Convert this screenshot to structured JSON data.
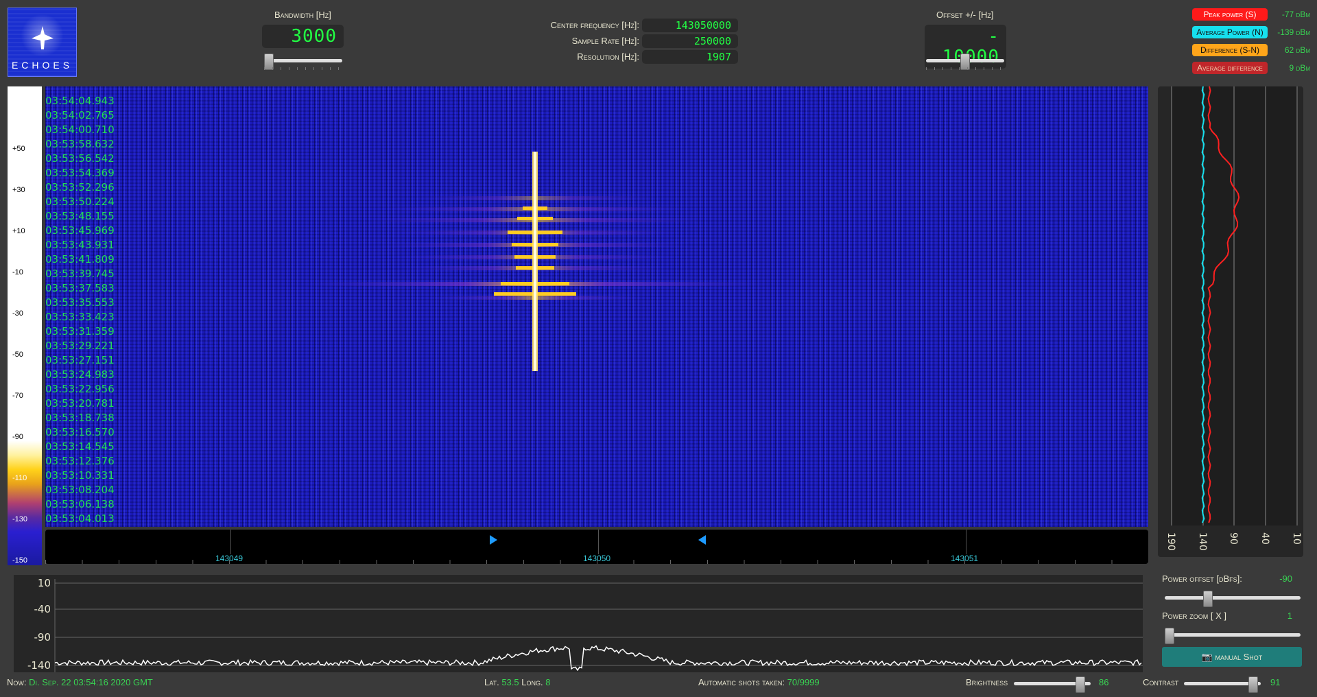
{
  "logo": {
    "text": "ECHOES"
  },
  "bandwidth": {
    "label": "Bandwidth [Hz]",
    "value": "3000"
  },
  "center": {
    "freq_label": "Center frequency [Hz]:",
    "freq_value": "143050000",
    "sr_label": "Sample Rate [Hz]:",
    "sr_value": "250000",
    "res_label": "Resolution [Hz]:",
    "res_value": "1907"
  },
  "offset": {
    "label": "Offset +/- [Hz]",
    "value": "- 10000"
  },
  "power": [
    {
      "label": "Peak power (S)",
      "value": "-77 dBm",
      "color": "#ff1a1a",
      "text_color": "#ffffff"
    },
    {
      "label": "Average Power (N)",
      "value": "-139 dBm",
      "color": "#16e0ee",
      "text_color": "#111111"
    },
    {
      "label": "Difference (S-N)",
      "value": "62 dBm",
      "color": "#ffa51a",
      "text_color": "#111111"
    },
    {
      "label": "Average difference",
      "value": "9 dBm",
      "color": "#c0262a",
      "text_color": "#f0d0b0"
    }
  ],
  "colorbar_ticks": [
    "+50",
    "+30",
    "+10",
    "-10",
    "-30",
    "-50",
    "-70",
    "-90",
    "-110",
    "-130",
    "-150"
  ],
  "timestamps": [
    "03:54:04.943",
    "03:54:02.765",
    "03:54:00.710",
    "03:53:58.632",
    "03:53:56.542",
    "03:53:54.369",
    "03:53:52.296",
    "03:53:50.224",
    "03:53:48.155",
    "03:53:45.969",
    "03:53:43.931",
    "03:53:41.809",
    "03:53:39.745",
    "03:53:37.583",
    "03:53:35.553",
    "03:53:33.423",
    "03:53:31.359",
    "03:53:29.221",
    "03:53:27.151",
    "03:53:24.983",
    "03:53:22.956",
    "03:53:20.781",
    "03:53:18.738",
    "03:53:16.570",
    "03:53:14.545",
    "03:53:12.376",
    "03:53:10.331",
    "03:53:08.204",
    "03:53:06.138",
    "03:53:04.013"
  ],
  "freq_axis": [
    "143049",
    "143050",
    "143051"
  ],
  "power_plot_ticks": [
    "190",
    "140",
    "90",
    "40",
    "10"
  ],
  "spectrum_ticks": [
    "10",
    "-40",
    "-90",
    "-140"
  ],
  "power_offset": {
    "label": "Power offset [dBfs]:",
    "value": "-90"
  },
  "power_zoom": {
    "label": "Power zoom  [ X ]",
    "value": "1"
  },
  "manual_shot": "manual Shot",
  "footer": {
    "now_label": "Now:",
    "now_value": "Di. Sep. 22 03:54:16 2020 GMT",
    "lat_label": "Lat.",
    "lat_value": "53.5",
    "long_label": "Long.",
    "long_value": "8",
    "shots_label": "Automatic shots taken:",
    "shots_value": "70/9999",
    "brightness_label": "Brightness",
    "brightness_value": "86",
    "contrast_label": "Contrast",
    "contrast_value": "91"
  }
}
